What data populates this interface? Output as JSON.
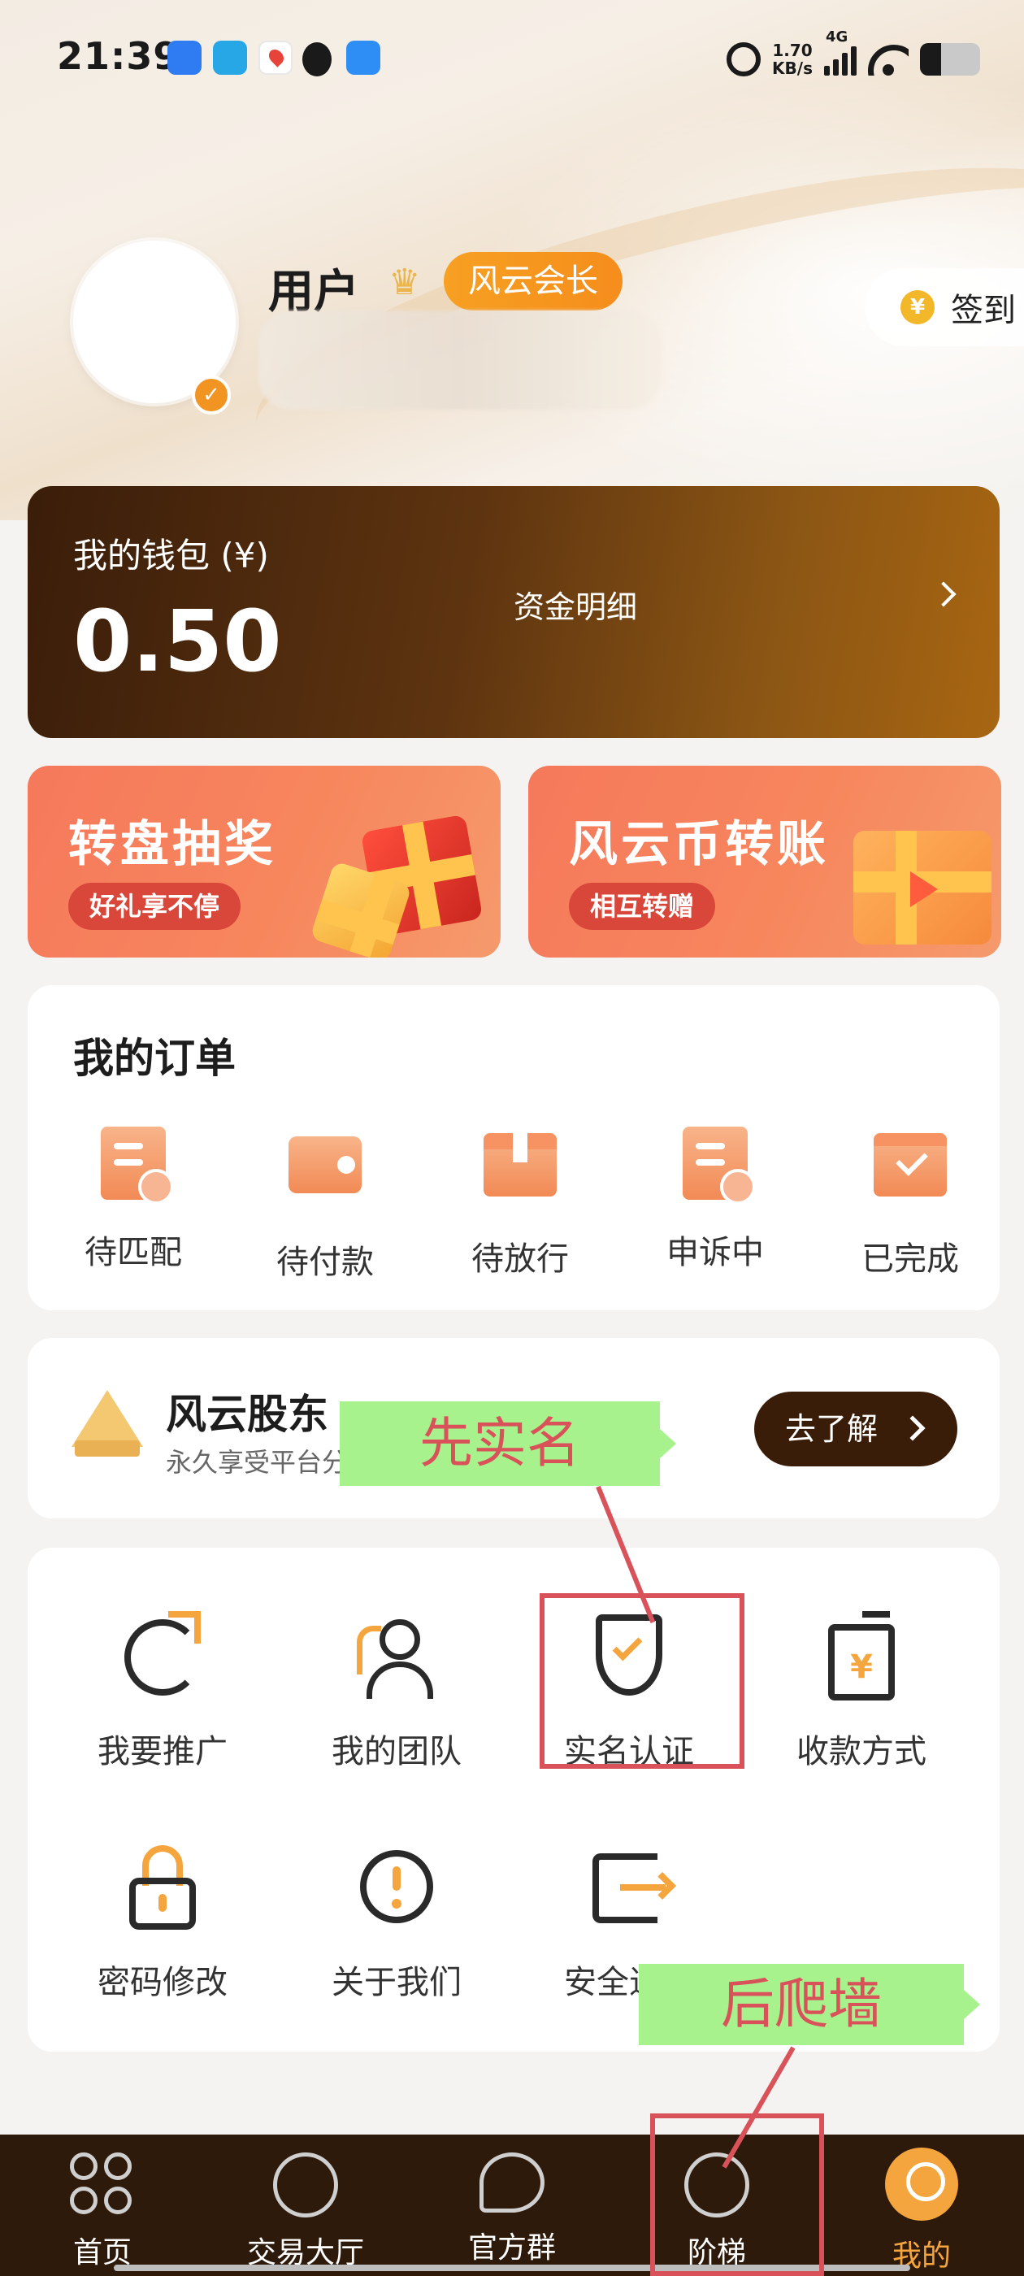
{
  "status_bar": {
    "time": "21:39",
    "net_speed_value": "1.70",
    "net_speed_unit": "KB/s",
    "network": "4G",
    "battery_level": 0.35,
    "app_icons": [
      "dingtalk-icon",
      "chat-app-icon",
      "map-icon",
      "qq-icon",
      "feishu-icon"
    ]
  },
  "profile": {
    "username": "用户",
    "level_badge": "风云会长",
    "checkin_label": "签到",
    "coin_symbol": "¥"
  },
  "wallet": {
    "title": "我的钱包 (¥)",
    "balance": "0.50",
    "detail_label": "资金明细"
  },
  "promos": [
    {
      "title": "转盘抽奖",
      "subtitle": "好礼享不停"
    },
    {
      "title": "风云币转账",
      "subtitle": "相互转赠"
    }
  ],
  "orders": {
    "title": "我的订单",
    "items": [
      {
        "label": "待匹配",
        "icon": "pending-match-icon"
      },
      {
        "label": "待付款",
        "icon": "pending-payment-icon"
      },
      {
        "label": "待放行",
        "icon": "pending-release-icon"
      },
      {
        "label": "申诉中",
        "icon": "appeal-icon"
      },
      {
        "label": "已完成",
        "icon": "completed-icon"
      }
    ]
  },
  "shareholder": {
    "title": "风云股东",
    "subtitle": "永久享受平台分",
    "button": "去了解"
  },
  "tools": [
    {
      "label": "我要推广",
      "icon": "promote-icon"
    },
    {
      "label": "我的团队",
      "icon": "team-icon"
    },
    {
      "label": "实名认证",
      "icon": "shield-check-icon"
    },
    {
      "label": "收款方式",
      "icon": "payment-method-icon"
    },
    {
      "label": "密码修改",
      "icon": "lock-icon"
    },
    {
      "label": "关于我们",
      "icon": "info-icon"
    },
    {
      "label": "安全退出",
      "icon": "logout-icon"
    }
  ],
  "bottom_nav": [
    {
      "label": "首页",
      "icon": "home-icon"
    },
    {
      "label": "交易大厅",
      "icon": "trading-hall-icon"
    },
    {
      "label": "官方群",
      "icon": "group-chat-icon"
    },
    {
      "label": "阶梯",
      "icon": "ladder-icon"
    },
    {
      "label": "我的",
      "icon": "profile-icon",
      "active": true
    }
  ],
  "annotations": {
    "step1": "先实名",
    "step2": "后爬墙"
  },
  "colors": {
    "accent": "#f5a53d",
    "wallet_dark": "#3a1d0a",
    "annotation_red": "#d9525a",
    "annotation_green": "#a8f28e"
  }
}
